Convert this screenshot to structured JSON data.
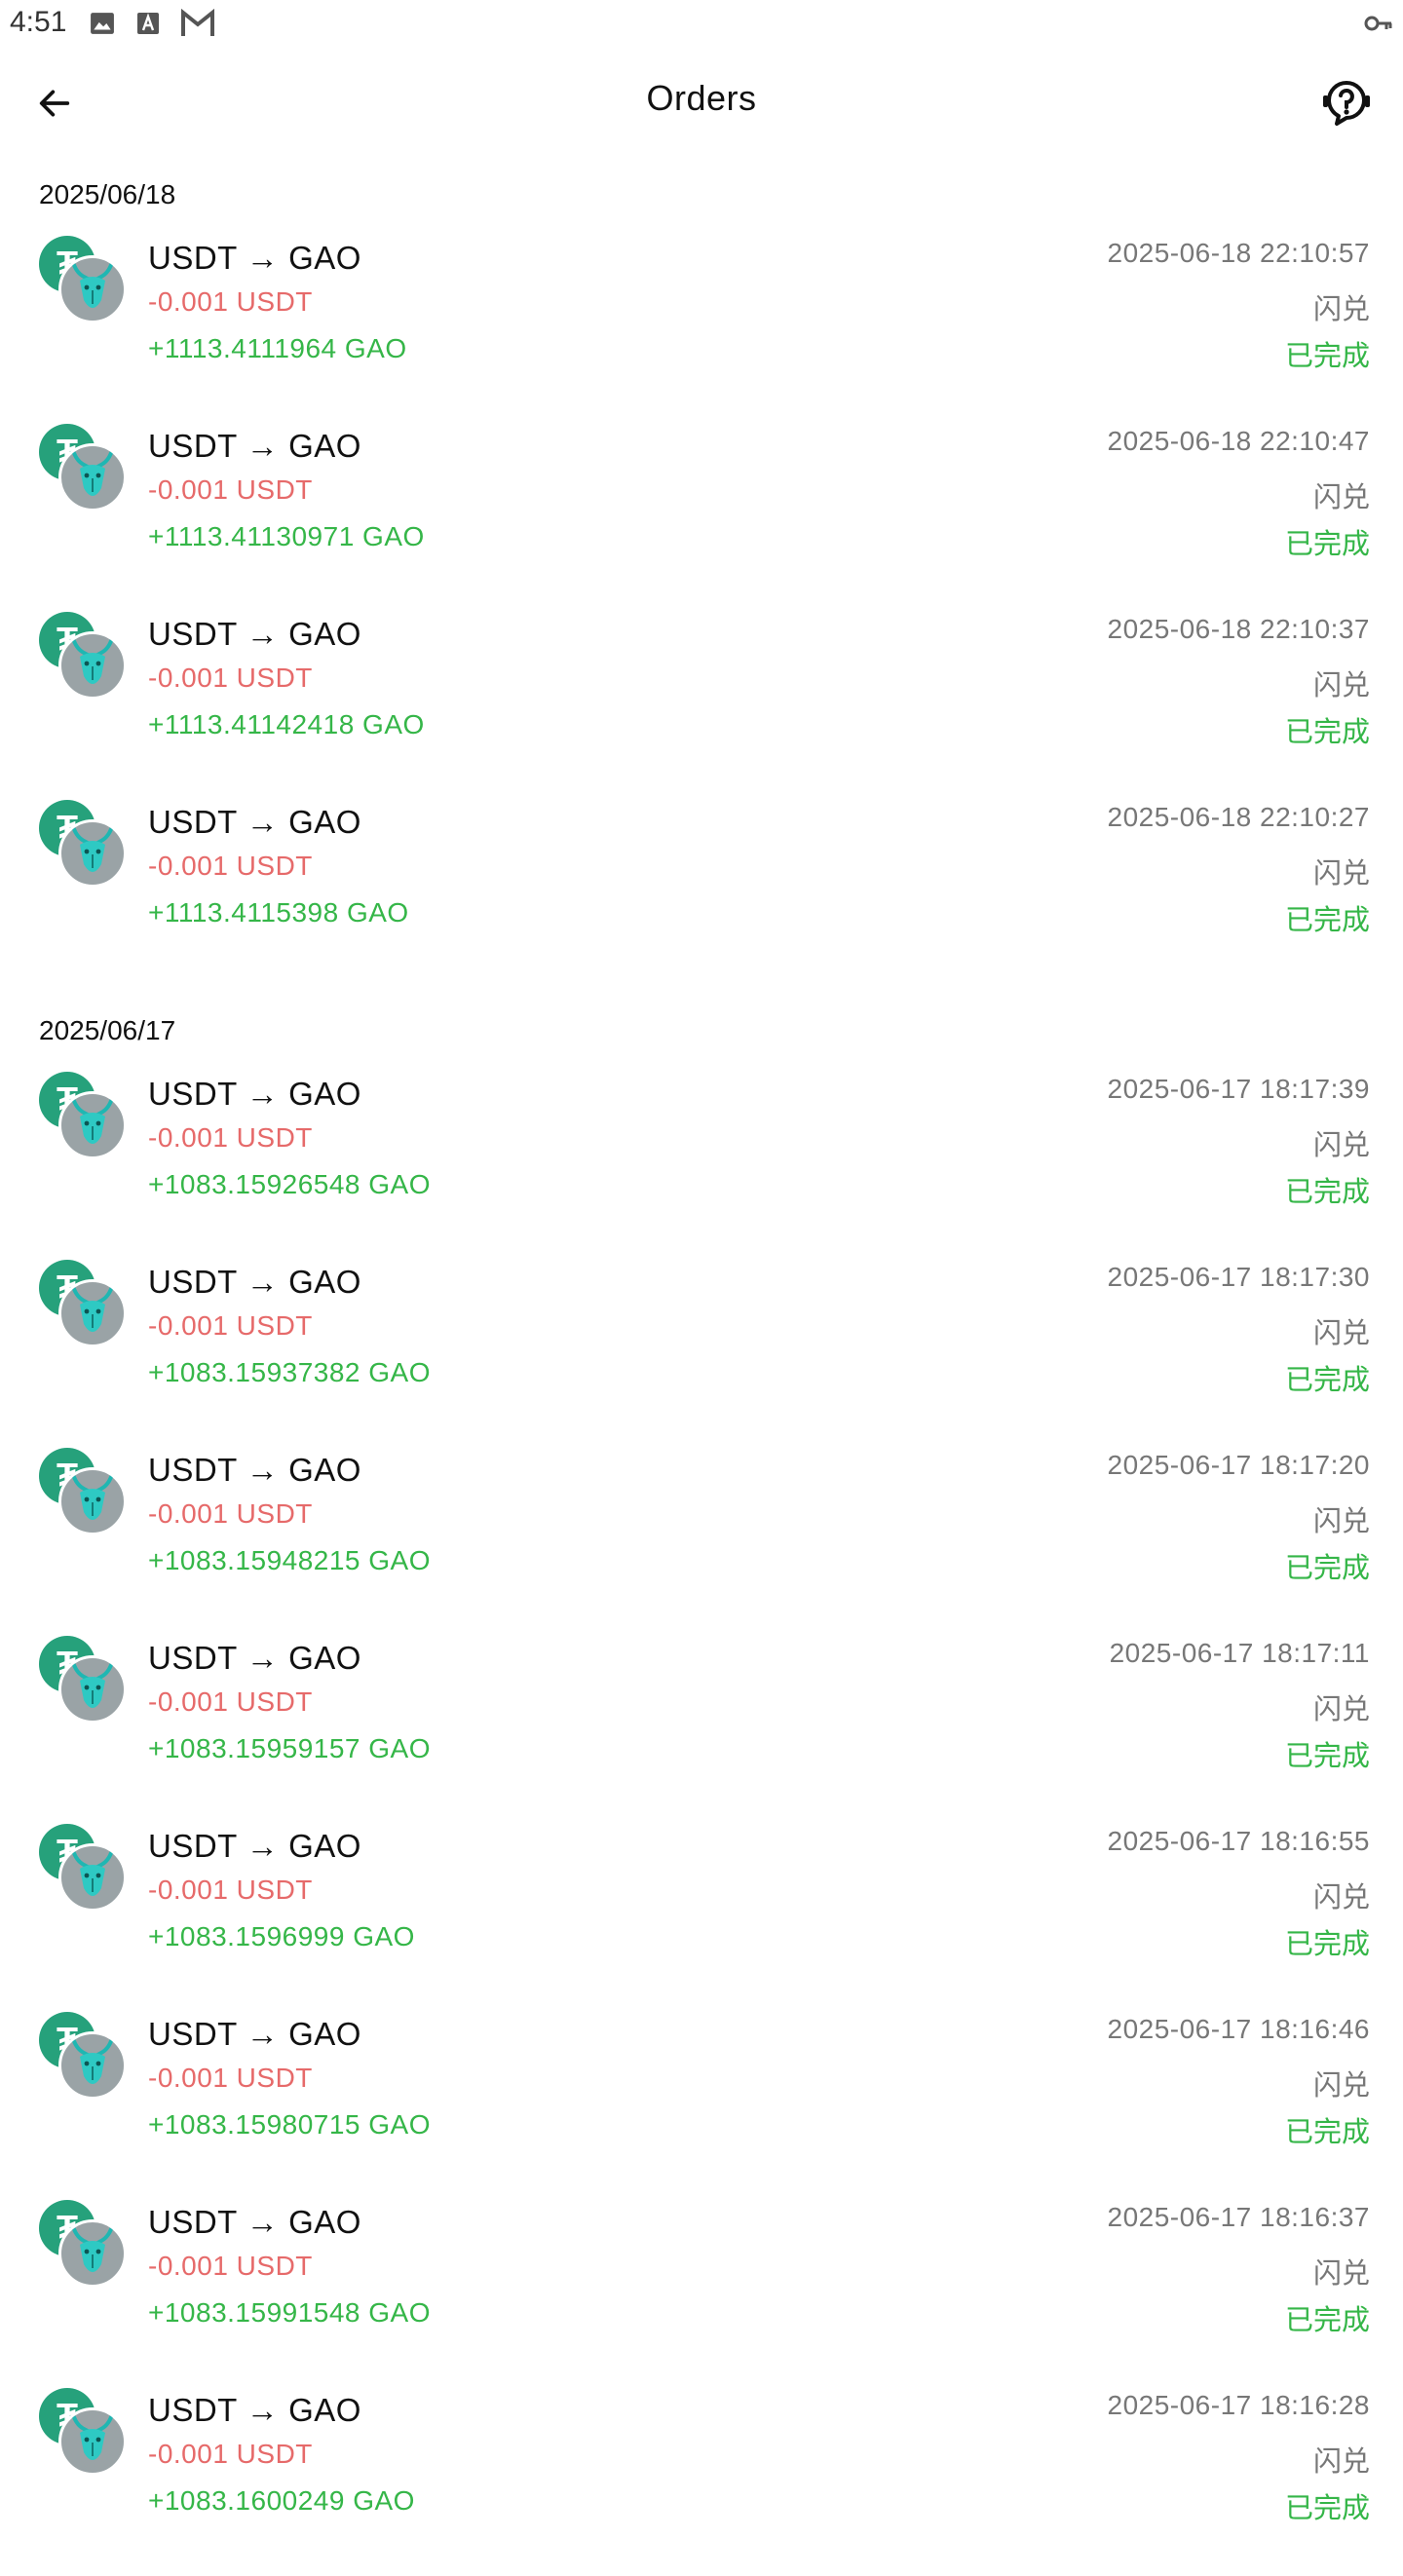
{
  "status_bar": {
    "time": "4:51",
    "icons": [
      "image-icon",
      "text-a-icon",
      "mail-icon",
      "vpn-key-icon"
    ]
  },
  "header": {
    "title": "Orders",
    "back_icon": "arrow-left-icon",
    "help_icon": "help-circle-icon"
  },
  "colors": {
    "negative": "#e66a6a",
    "positive": "#35b648",
    "muted": "#777777",
    "usdt": "#26a17b",
    "gao": "#2ec9c3"
  },
  "groups": [
    {
      "date": "2025/06/18",
      "orders": [
        {
          "pair": "USDT → GAO",
          "out": "-0.001 USDT",
          "in": "+1113.4111964 GAO",
          "time": "2025-06-18 22:10:57",
          "type": "闪兑",
          "status": "已完成"
        },
        {
          "pair": "USDT → GAO",
          "out": "-0.001 USDT",
          "in": "+1113.41130971 GAO",
          "time": "2025-06-18 22:10:47",
          "type": "闪兑",
          "status": "已完成"
        },
        {
          "pair": "USDT → GAO",
          "out": "-0.001 USDT",
          "in": "+1113.41142418 GAO",
          "time": "2025-06-18 22:10:37",
          "type": "闪兑",
          "status": "已完成"
        },
        {
          "pair": "USDT → GAO",
          "out": "-0.001 USDT",
          "in": "+1113.4115398 GAO",
          "time": "2025-06-18 22:10:27",
          "type": "闪兑",
          "status": "已完成"
        }
      ]
    },
    {
      "date": "2025/06/17",
      "orders": [
        {
          "pair": "USDT → GAO",
          "out": "-0.001 USDT",
          "in": "+1083.15926548 GAO",
          "time": "2025-06-17 18:17:39",
          "type": "闪兑",
          "status": "已完成"
        },
        {
          "pair": "USDT → GAO",
          "out": "-0.001 USDT",
          "in": "+1083.15937382 GAO",
          "time": "2025-06-17 18:17:30",
          "type": "闪兑",
          "status": "已完成"
        },
        {
          "pair": "USDT → GAO",
          "out": "-0.001 USDT",
          "in": "+1083.15948215 GAO",
          "time": "2025-06-17 18:17:20",
          "type": "闪兑",
          "status": "已完成"
        },
        {
          "pair": "USDT → GAO",
          "out": "-0.001 USDT",
          "in": "+1083.15959157 GAO",
          "time": "2025-06-17 18:17:11",
          "type": "闪兑",
          "status": "已完成"
        },
        {
          "pair": "USDT → GAO",
          "out": "-0.001 USDT",
          "in": "+1083.1596999 GAO",
          "time": "2025-06-17 18:16:55",
          "type": "闪兑",
          "status": "已完成"
        },
        {
          "pair": "USDT → GAO",
          "out": "-0.001 USDT",
          "in": "+1083.15980715 GAO",
          "time": "2025-06-17 18:16:46",
          "type": "闪兑",
          "status": "已完成"
        },
        {
          "pair": "USDT → GAO",
          "out": "-0.001 USDT",
          "in": "+1083.15991548 GAO",
          "time": "2025-06-17 18:16:37",
          "type": "闪兑",
          "status": "已完成"
        },
        {
          "pair": "USDT → GAO",
          "out": "-0.001 USDT",
          "in": "+1083.1600249 GAO",
          "time": "2025-06-17 18:16:28",
          "type": "闪兑",
          "status": "已完成"
        }
      ]
    }
  ]
}
